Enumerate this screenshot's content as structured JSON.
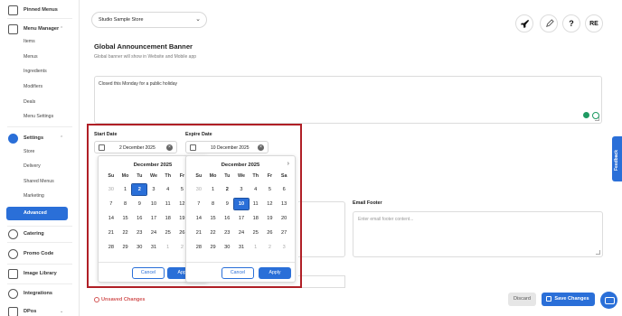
{
  "sidebar": {
    "pinned": "Pinned Menus",
    "menu_manager": "Menu Manager",
    "menu_items": [
      "Items",
      "Menus",
      "Ingredients",
      "Modifiers",
      "Deals",
      "Menu Settings"
    ],
    "settings": "Settings",
    "settings_items": [
      "Store",
      "Delivery",
      "Shared Menus",
      "Marketing"
    ],
    "active_item": "Advanced",
    "catering": "Catering",
    "promo": "Promo Code",
    "image_library": "Image Library",
    "integrations": "Integrations",
    "dpos": "DPos"
  },
  "topbar": {
    "store": "Studio Sample Store",
    "help": "?",
    "avatar": "RE"
  },
  "page": {
    "title": "Global Announcement Banner",
    "subtitle": "Global banner will show in Website and Mobile app",
    "announcement": "Closed this Monday for a public holiday"
  },
  "email": {
    "footer_label": "Email Footer",
    "footer_placeholder": "Enter email footer content..."
  },
  "feedback": "Feedback",
  "start": {
    "label": "Start Date",
    "value": "2 December 2025",
    "month": "December 2025",
    "cancel": "Cancel",
    "apply": "Apply"
  },
  "expire": {
    "label": "Expire Date",
    "value": "10 December 2025",
    "month": "December 2025",
    "cancel": "Cancel",
    "apply": "Apply"
  },
  "weekdays": [
    "Su",
    "Mo",
    "Tu",
    "We",
    "Th",
    "Fr",
    "Sa"
  ],
  "calendar_days": [
    [
      "30",
      "1",
      "2",
      "3",
      "4",
      "5",
      "6"
    ],
    [
      "7",
      "8",
      "9",
      "10",
      "11",
      "12",
      "13"
    ],
    [
      "14",
      "15",
      "16",
      "17",
      "18",
      "19",
      "20"
    ],
    [
      "21",
      "22",
      "23",
      "24",
      "25",
      "26",
      "27"
    ],
    [
      "28",
      "29",
      "30",
      "31",
      "1",
      "2",
      "3"
    ]
  ],
  "footer": {
    "unsaved": "Unsaved Changes",
    "discard": "Discard",
    "save": "Save Changes"
  },
  "colors": {
    "accent": "#2a6fd8",
    "highlight": "#b01f26"
  }
}
